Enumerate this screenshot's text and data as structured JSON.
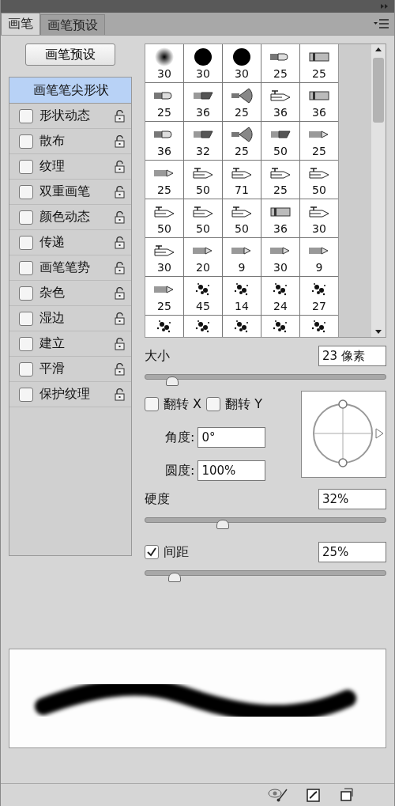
{
  "tabs": [
    {
      "label": "画笔",
      "selected": true
    },
    {
      "label": "画笔预设",
      "selected": false
    }
  ],
  "presets_button": "画笔预设",
  "tip_shape": {
    "label": "画笔笔尖形状",
    "selected": true
  },
  "options": [
    {
      "label": "形状动态",
      "checked": false
    },
    {
      "label": "散布",
      "checked": false
    },
    {
      "label": "纹理",
      "checked": false
    },
    {
      "label": "双重画笔",
      "checked": false
    },
    {
      "label": "颜色动态",
      "checked": false
    },
    {
      "label": "传递",
      "checked": false
    },
    {
      "label": "画笔笔势",
      "checked": false
    },
    {
      "label": "杂色",
      "checked": false
    },
    {
      "label": "湿边",
      "checked": false
    },
    {
      "label": "建立",
      "checked": false
    },
    {
      "label": "平滑",
      "checked": false
    },
    {
      "label": "保护纹理",
      "checked": false
    }
  ],
  "brushes": [
    {
      "kind": "soft",
      "size": "30"
    },
    {
      "kind": "hard",
      "size": "30"
    },
    {
      "kind": "hard",
      "size": "30"
    },
    {
      "kind": "round-tip",
      "size": "25"
    },
    {
      "kind": "flat",
      "size": "25"
    },
    {
      "kind": "round-tip",
      "size": "25"
    },
    {
      "kind": "angled",
      "size": "36"
    },
    {
      "kind": "fan",
      "size": "25"
    },
    {
      "kind": "pen",
      "size": "36"
    },
    {
      "kind": "flat",
      "size": "36"
    },
    {
      "kind": "round-tip",
      "size": "36"
    },
    {
      "kind": "angled",
      "size": "32"
    },
    {
      "kind": "fan",
      "size": "25"
    },
    {
      "kind": "angled",
      "size": "50"
    },
    {
      "kind": "pencil",
      "size": "25"
    },
    {
      "kind": "pencil",
      "size": "25"
    },
    {
      "kind": "pen",
      "size": "50"
    },
    {
      "kind": "pen",
      "size": "71"
    },
    {
      "kind": "pen",
      "size": "25"
    },
    {
      "kind": "pen",
      "size": "50"
    },
    {
      "kind": "pen",
      "size": "50"
    },
    {
      "kind": "pen",
      "size": "50"
    },
    {
      "kind": "pen",
      "size": "50"
    },
    {
      "kind": "flat",
      "size": "36"
    },
    {
      "kind": "pen",
      "size": "30"
    },
    {
      "kind": "pen",
      "size": "30"
    },
    {
      "kind": "pencil",
      "size": "20"
    },
    {
      "kind": "pencil",
      "size": "9"
    },
    {
      "kind": "pencil",
      "size": "30"
    },
    {
      "kind": "pencil",
      "size": "9"
    },
    {
      "kind": "pencil",
      "size": "25"
    },
    {
      "kind": "splatter",
      "size": "45"
    },
    {
      "kind": "splatter",
      "size": "14"
    },
    {
      "kind": "splatter",
      "size": "24"
    },
    {
      "kind": "splatter",
      "size": "27"
    },
    {
      "kind": "splatter"
    },
    {
      "kind": "splatter"
    },
    {
      "kind": "splatter"
    },
    {
      "kind": "splatter"
    },
    {
      "kind": "splatter"
    }
  ],
  "size": {
    "label": "大小",
    "value": "23 像素",
    "level": 0.11
  },
  "flip": [
    {
      "label": "翻转 X",
      "checked": false
    },
    {
      "label": "翻转 Y",
      "checked": false
    }
  ],
  "angle": {
    "label": "角度:",
    "value": "0°"
  },
  "roundness": {
    "label": "圆度:",
    "value": "100%"
  },
  "hardness": {
    "label": "硬度",
    "value": "32%",
    "level": 0.32
  },
  "spacing": {
    "label": "间距",
    "checked": true,
    "value": "25%",
    "level": 0.12
  }
}
